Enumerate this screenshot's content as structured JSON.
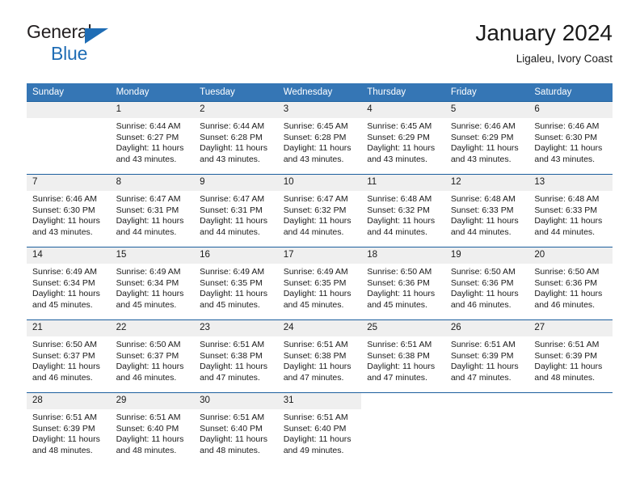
{
  "brand": {
    "name_part1": "General",
    "name_part2": "Blue",
    "triangle_icon": "triangle-icon",
    "accent_color": "#1f6db5"
  },
  "header": {
    "title": "January 2024",
    "subtitle": "Ligaleu, Ivory Coast"
  },
  "colors": {
    "header_row": "#3576b5",
    "week_divider": "#1c5f9e",
    "daynum_band": "#efefef",
    "text": "#1a1a1a"
  },
  "weekdays": [
    "Sunday",
    "Monday",
    "Tuesday",
    "Wednesday",
    "Thursday",
    "Friday",
    "Saturday"
  ],
  "labels": {
    "sunrise": "Sunrise:",
    "sunset": "Sunset:",
    "daylight": "Daylight:"
  },
  "weeks": [
    [
      {
        "day": "",
        "empty": true
      },
      {
        "day": "1",
        "sunrise": "Sunrise: 6:44 AM",
        "sunset": "Sunset: 6:27 PM",
        "daylight_l1": "Daylight: 11 hours",
        "daylight_l2": "and 43 minutes."
      },
      {
        "day": "2",
        "sunrise": "Sunrise: 6:44 AM",
        "sunset": "Sunset: 6:28 PM",
        "daylight_l1": "Daylight: 11 hours",
        "daylight_l2": "and 43 minutes."
      },
      {
        "day": "3",
        "sunrise": "Sunrise: 6:45 AM",
        "sunset": "Sunset: 6:28 PM",
        "daylight_l1": "Daylight: 11 hours",
        "daylight_l2": "and 43 minutes."
      },
      {
        "day": "4",
        "sunrise": "Sunrise: 6:45 AM",
        "sunset": "Sunset: 6:29 PM",
        "daylight_l1": "Daylight: 11 hours",
        "daylight_l2": "and 43 minutes."
      },
      {
        "day": "5",
        "sunrise": "Sunrise: 6:46 AM",
        "sunset": "Sunset: 6:29 PM",
        "daylight_l1": "Daylight: 11 hours",
        "daylight_l2": "and 43 minutes."
      },
      {
        "day": "6",
        "sunrise": "Sunrise: 6:46 AM",
        "sunset": "Sunset: 6:30 PM",
        "daylight_l1": "Daylight: 11 hours",
        "daylight_l2": "and 43 minutes."
      }
    ],
    [
      {
        "day": "7",
        "sunrise": "Sunrise: 6:46 AM",
        "sunset": "Sunset: 6:30 PM",
        "daylight_l1": "Daylight: 11 hours",
        "daylight_l2": "and 43 minutes."
      },
      {
        "day": "8",
        "sunrise": "Sunrise: 6:47 AM",
        "sunset": "Sunset: 6:31 PM",
        "daylight_l1": "Daylight: 11 hours",
        "daylight_l2": "and 44 minutes."
      },
      {
        "day": "9",
        "sunrise": "Sunrise: 6:47 AM",
        "sunset": "Sunset: 6:31 PM",
        "daylight_l1": "Daylight: 11 hours",
        "daylight_l2": "and 44 minutes."
      },
      {
        "day": "10",
        "sunrise": "Sunrise: 6:47 AM",
        "sunset": "Sunset: 6:32 PM",
        "daylight_l1": "Daylight: 11 hours",
        "daylight_l2": "and 44 minutes."
      },
      {
        "day": "11",
        "sunrise": "Sunrise: 6:48 AM",
        "sunset": "Sunset: 6:32 PM",
        "daylight_l1": "Daylight: 11 hours",
        "daylight_l2": "and 44 minutes."
      },
      {
        "day": "12",
        "sunrise": "Sunrise: 6:48 AM",
        "sunset": "Sunset: 6:33 PM",
        "daylight_l1": "Daylight: 11 hours",
        "daylight_l2": "and 44 minutes."
      },
      {
        "day": "13",
        "sunrise": "Sunrise: 6:48 AM",
        "sunset": "Sunset: 6:33 PM",
        "daylight_l1": "Daylight: 11 hours",
        "daylight_l2": "and 44 minutes."
      }
    ],
    [
      {
        "day": "14",
        "sunrise": "Sunrise: 6:49 AM",
        "sunset": "Sunset: 6:34 PM",
        "daylight_l1": "Daylight: 11 hours",
        "daylight_l2": "and 45 minutes."
      },
      {
        "day": "15",
        "sunrise": "Sunrise: 6:49 AM",
        "sunset": "Sunset: 6:34 PM",
        "daylight_l1": "Daylight: 11 hours",
        "daylight_l2": "and 45 minutes."
      },
      {
        "day": "16",
        "sunrise": "Sunrise: 6:49 AM",
        "sunset": "Sunset: 6:35 PM",
        "daylight_l1": "Daylight: 11 hours",
        "daylight_l2": "and 45 minutes."
      },
      {
        "day": "17",
        "sunrise": "Sunrise: 6:49 AM",
        "sunset": "Sunset: 6:35 PM",
        "daylight_l1": "Daylight: 11 hours",
        "daylight_l2": "and 45 minutes."
      },
      {
        "day": "18",
        "sunrise": "Sunrise: 6:50 AM",
        "sunset": "Sunset: 6:36 PM",
        "daylight_l1": "Daylight: 11 hours",
        "daylight_l2": "and 45 minutes."
      },
      {
        "day": "19",
        "sunrise": "Sunrise: 6:50 AM",
        "sunset": "Sunset: 6:36 PM",
        "daylight_l1": "Daylight: 11 hours",
        "daylight_l2": "and 46 minutes."
      },
      {
        "day": "20",
        "sunrise": "Sunrise: 6:50 AM",
        "sunset": "Sunset: 6:36 PM",
        "daylight_l1": "Daylight: 11 hours",
        "daylight_l2": "and 46 minutes."
      }
    ],
    [
      {
        "day": "21",
        "sunrise": "Sunrise: 6:50 AM",
        "sunset": "Sunset: 6:37 PM",
        "daylight_l1": "Daylight: 11 hours",
        "daylight_l2": "and 46 minutes."
      },
      {
        "day": "22",
        "sunrise": "Sunrise: 6:50 AM",
        "sunset": "Sunset: 6:37 PM",
        "daylight_l1": "Daylight: 11 hours",
        "daylight_l2": "and 46 minutes."
      },
      {
        "day": "23",
        "sunrise": "Sunrise: 6:51 AM",
        "sunset": "Sunset: 6:38 PM",
        "daylight_l1": "Daylight: 11 hours",
        "daylight_l2": "and 47 minutes."
      },
      {
        "day": "24",
        "sunrise": "Sunrise: 6:51 AM",
        "sunset": "Sunset: 6:38 PM",
        "daylight_l1": "Daylight: 11 hours",
        "daylight_l2": "and 47 minutes."
      },
      {
        "day": "25",
        "sunrise": "Sunrise: 6:51 AM",
        "sunset": "Sunset: 6:38 PM",
        "daylight_l1": "Daylight: 11 hours",
        "daylight_l2": "and 47 minutes."
      },
      {
        "day": "26",
        "sunrise": "Sunrise: 6:51 AM",
        "sunset": "Sunset: 6:39 PM",
        "daylight_l1": "Daylight: 11 hours",
        "daylight_l2": "and 47 minutes."
      },
      {
        "day": "27",
        "sunrise": "Sunrise: 6:51 AM",
        "sunset": "Sunset: 6:39 PM",
        "daylight_l1": "Daylight: 11 hours",
        "daylight_l2": "and 48 minutes."
      }
    ],
    [
      {
        "day": "28",
        "sunrise": "Sunrise: 6:51 AM",
        "sunset": "Sunset: 6:39 PM",
        "daylight_l1": "Daylight: 11 hours",
        "daylight_l2": "and 48 minutes."
      },
      {
        "day": "29",
        "sunrise": "Sunrise: 6:51 AM",
        "sunset": "Sunset: 6:40 PM",
        "daylight_l1": "Daylight: 11 hours",
        "daylight_l2": "and 48 minutes."
      },
      {
        "day": "30",
        "sunrise": "Sunrise: 6:51 AM",
        "sunset": "Sunset: 6:40 PM",
        "daylight_l1": "Daylight: 11 hours",
        "daylight_l2": "and 48 minutes."
      },
      {
        "day": "31",
        "sunrise": "Sunrise: 6:51 AM",
        "sunset": "Sunset: 6:40 PM",
        "daylight_l1": "Daylight: 11 hours",
        "daylight_l2": "and 49 minutes."
      },
      {
        "day": "",
        "empty": true,
        "blank": true
      },
      {
        "day": "",
        "empty": true,
        "blank": true
      },
      {
        "day": "",
        "empty": true,
        "blank": true
      }
    ]
  ]
}
